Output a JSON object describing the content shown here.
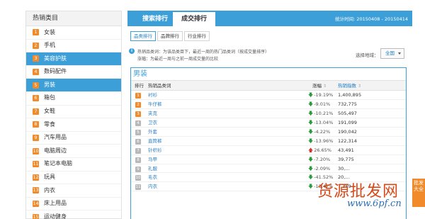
{
  "sidebar": {
    "title": "热销类目",
    "items": [
      {
        "num": "1",
        "label": "女装"
      },
      {
        "num": "2",
        "label": "手机"
      },
      {
        "num": "3",
        "label": "美容护肤"
      },
      {
        "num": "4",
        "label": "数码配件"
      },
      {
        "num": "5",
        "label": "男装"
      },
      {
        "num": "6",
        "label": "箱包"
      },
      {
        "num": "7",
        "label": "女鞋"
      },
      {
        "num": "8",
        "label": "零食"
      },
      {
        "num": "9",
        "label": "汽车用品"
      },
      {
        "num": "10",
        "label": "电脑周边"
      },
      {
        "num": "11",
        "label": "笔记本电脑"
      },
      {
        "num": "12",
        "label": "玩具"
      },
      {
        "num": "13",
        "label": "内衣"
      },
      {
        "num": "14",
        "label": "床上用品"
      },
      {
        "num": "15",
        "label": "运动健身"
      }
    ]
  },
  "tabs": {
    "search_rank": "搜索排行",
    "deal_rank": "成交排行"
  },
  "stat_time": "统计时间: 20150408 - 20150414",
  "subtabs": [
    "品类排行",
    "品牌排行",
    "行业排行"
  ],
  "info": {
    "line1": "热销品类词：为该品类目下，最近一周的热门品类词（按成交量排序）",
    "line2": "涨幅：为最近一周与之前一周成交量的比较",
    "icon": "i"
  },
  "region": {
    "label": "选择地域：",
    "value": "全国"
  },
  "panel": {
    "title": "男装",
    "headers": {
      "rank": "排行",
      "name": "热销品类词",
      "change": "涨幅",
      "index": "热销指数"
    },
    "rows": [
      {
        "rank": "1",
        "name": "衬衫",
        "dir": "down",
        "change": "-19.19%",
        "index": "1,400,895"
      },
      {
        "rank": "2",
        "name": "牛仔裤",
        "dir": "down",
        "change": "-9.01%",
        "index": "732,775"
      },
      {
        "rank": "3",
        "name": "夹克",
        "dir": "down",
        "change": "-10.21%",
        "index": "505,497"
      },
      {
        "rank": "4",
        "name": "卫衣",
        "dir": "down",
        "change": "-13.04%",
        "index": "191,099"
      },
      {
        "rank": "5",
        "name": "外套",
        "dir": "down",
        "change": "-4.22%",
        "index": "190,042"
      },
      {
        "rank": "6",
        "name": "直筒裤",
        "dir": "down",
        "change": "-13.96%",
        "index": "122,314"
      },
      {
        "rank": "7",
        "name": "针织衫",
        "dir": "up",
        "change": "26.65%",
        "index": "43,491"
      },
      {
        "rank": "8",
        "name": "马甲",
        "dir": "down",
        "change": "-7.20%",
        "index": "39,775"
      },
      {
        "rank": "9",
        "name": "礼服",
        "dir": "down",
        "change": "-2.09%",
        "index": "30,…"
      },
      {
        "rank": "10",
        "name": "毛衣",
        "dir": "down",
        "change": "-41.52%",
        "index": "20,…"
      },
      {
        "rank": "11",
        "name": "内衣",
        "dir": "down",
        "change": "-13.47%",
        "index": "7,289"
      }
    ]
  },
  "watermark": {
    "text": "货源批发网",
    "url": "www.6pf.cn",
    "badge": "批发大全"
  },
  "colors": {
    "accent": "#3d9fd8",
    "rank_badge": "#f08a2a",
    "down": "#2a9d3a",
    "up": "#d9342b"
  }
}
